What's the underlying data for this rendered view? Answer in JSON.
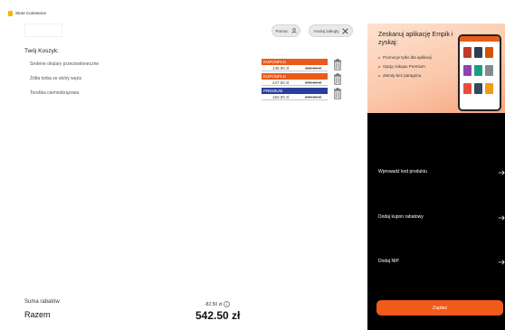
{
  "window": {
    "title": "Store Commerce"
  },
  "toolbar": {
    "help_label": "Pomoc",
    "cancel_label": "Anuluj zakupy"
  },
  "cart": {
    "title": "Twój Koszyk:",
    "items": [
      {
        "name": "Srebrne okulary przeciwsłoneczne",
        "badge": "KUPONPLN",
        "badge_color": "#ea5a1a",
        "price": "135.00 zł",
        "old_price": "150.00 zł"
      },
      {
        "name": "Żółta torba ze skóry węża",
        "badge": "KUPONPLN",
        "badge_color": "#ea5a1a",
        "price": "247.50 zł",
        "old_price": "275.00 zł"
      },
      {
        "name": "Torebka ciemnobrązowa",
        "badge": "PREMIUM",
        "badge_color": "#2a3f9a",
        "price": "160.00 zł",
        "old_price": "200.00 zł"
      }
    ]
  },
  "summary": {
    "discount_label": "Suma rabatów",
    "discount_value": "-82.50 zł",
    "total_label": "Razem",
    "total_value": "542.50 zł"
  },
  "promo": {
    "title": "Zeskanuj aplikację Empik i zyskaj:",
    "bullets": [
      "Promocje tylko dla aplikacji",
      "Opcję zakupu Premium",
      "Zwroty bez paragonu"
    ]
  },
  "actions": {
    "product_code_label": "Wprowadź kod produktu",
    "coupon_label": "Dodaj kupon rabatowy",
    "nip_label": "Dodaj NIP",
    "pay_label": "Zapłać"
  },
  "colors": {
    "accent": "#f05a1a",
    "premium": "#2a3f9a",
    "panel": "#000000"
  },
  "icons": {
    "help": "person-icon",
    "cancel": "close-icon",
    "remove": "trash-icon",
    "info": "info-icon",
    "arrow": "arrow-right-icon"
  }
}
